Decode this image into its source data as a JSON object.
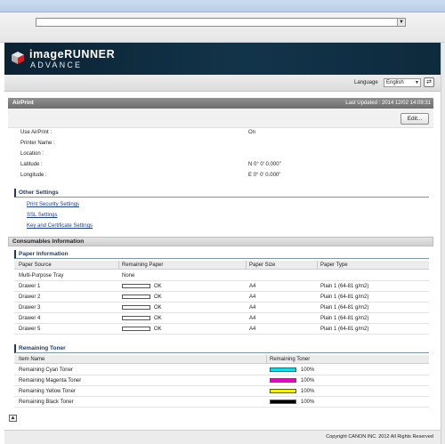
{
  "language": {
    "label": "Language",
    "selected": "English"
  },
  "brand": {
    "line1": "imageRUNNER",
    "line2": "ADVANCE"
  },
  "airprint": {
    "title": "AirPrint",
    "last_updated": "Last Updated : 2014 12/02 14:09:31",
    "edit_label": "Edit...",
    "fields": [
      {
        "label": "Use AirPrint :",
        "value": "On"
      },
      {
        "label": "Printer Name :",
        "value": ""
      },
      {
        "label": "Location :",
        "value": ""
      },
      {
        "label": "Latitude :",
        "value": "N 0° 0' 0.000\""
      },
      {
        "label": "Longitude :",
        "value": "E 0° 0' 0.000\""
      }
    ]
  },
  "other_settings": {
    "title": "Other Settings",
    "links": [
      "Print Security Settings",
      "SSL Settings",
      "Key and Certificate Settings"
    ]
  },
  "consumables": {
    "title": "Consumables Information",
    "paper_title": "Paper Information",
    "paper_headers": [
      "Paper Source",
      "Remaining Paper",
      "Paper Size",
      "Paper Type"
    ],
    "paper_rows": [
      {
        "source": "Multi-Purpose Tray",
        "remaining": "None",
        "size": "",
        "type": "",
        "bar": false
      },
      {
        "source": "Drawer 1",
        "remaining": "OK",
        "size": "A4",
        "type": "Plain 1 (64-81 g/m2)",
        "bar": true
      },
      {
        "source": "Drawer 2",
        "remaining": "OK",
        "size": "A4",
        "type": "Plain 1 (64-81 g/m2)",
        "bar": true
      },
      {
        "source": "Drawer 3",
        "remaining": "OK",
        "size": "A4",
        "type": "Plain 1 (64-81 g/m2)",
        "bar": true
      },
      {
        "source": "Drawer 4",
        "remaining": "OK",
        "size": "A4",
        "type": "Plain 1 (64-81 g/m2)",
        "bar": true
      },
      {
        "source": "Drawer 5",
        "remaining": "OK",
        "size": "A4",
        "type": "Plain 1 (64-81 g/m2)",
        "bar": true
      }
    ],
    "toner_title": "Remaining Toner",
    "toner_headers": [
      "Item Name",
      "Remaining Toner"
    ],
    "toner_rows": [
      {
        "name": "Remaining Cyan Toner",
        "level": "100%",
        "color": "#00e5f0"
      },
      {
        "name": "Remaining Magenta Toner",
        "level": "100%",
        "color": "#f000c8"
      },
      {
        "name": "Remaining Yellow Toner",
        "level": "100%",
        "color": "#f2f200"
      },
      {
        "name": "Remaining Black Toner",
        "level": "100%",
        "color": "#000000"
      }
    ]
  },
  "footer": {
    "copyright": "Copyright CANON INC. 2012 All Rights Reserved"
  }
}
